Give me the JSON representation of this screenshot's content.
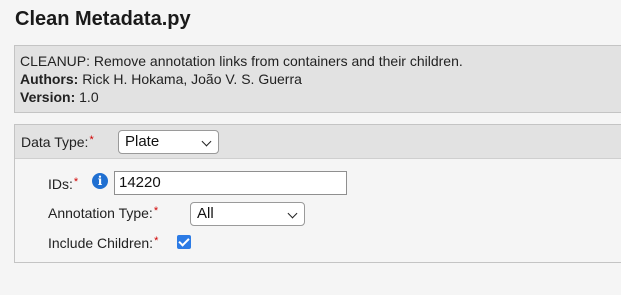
{
  "script": {
    "title": "Clean Metadata.py",
    "description": "CLEANUP: Remove annotation links from containers and their children.",
    "authors_label": "Authors:",
    "authors_value": "Rick H. Hokama, João V. S. Guerra",
    "version_label": "Version:",
    "version_value": "1.0"
  },
  "form": {
    "data_type": {
      "label": "Data Type:",
      "required_mark": "*",
      "selected": "Plate"
    },
    "ids": {
      "label": "IDs:",
      "required_mark": "*",
      "info_icon": "i",
      "value": "14220"
    },
    "annotation_type": {
      "label": "Annotation Type:",
      "required_mark": "*",
      "selected": "All"
    },
    "include_children": {
      "label": "Include Children:",
      "required_mark": "*",
      "checked": true
    }
  },
  "colors": {
    "required": "#d00000",
    "info_icon": "#1f6fd1",
    "checkbox": "#2c7be5"
  }
}
